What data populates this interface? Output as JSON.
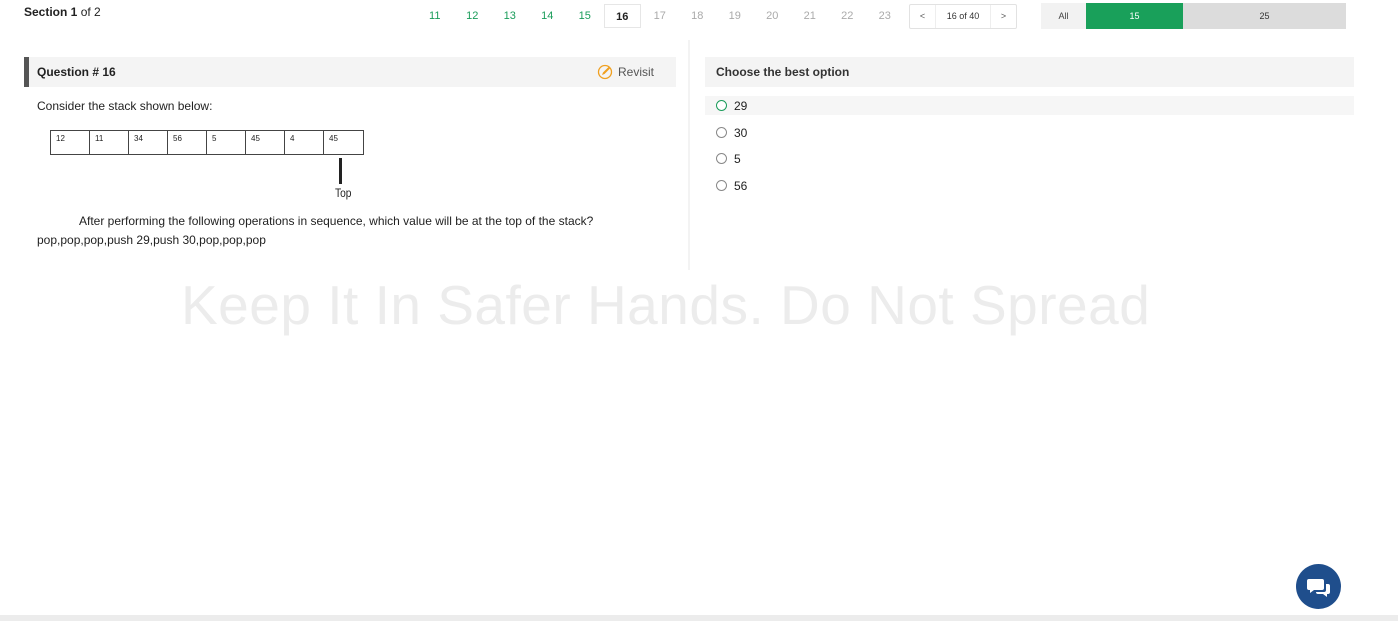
{
  "section": {
    "bold": "Section 1",
    "rest": " of 2"
  },
  "question_nav": [
    {
      "label": "11",
      "state": "answered"
    },
    {
      "label": "12",
      "state": "answered"
    },
    {
      "label": "13",
      "state": "answered"
    },
    {
      "label": "14",
      "state": "answered"
    },
    {
      "label": "15",
      "state": "answered"
    },
    {
      "label": "16",
      "state": "current"
    },
    {
      "label": "17",
      "state": "unvisited"
    },
    {
      "label": "18",
      "state": "unvisited"
    },
    {
      "label": "19",
      "state": "unvisited"
    },
    {
      "label": "20",
      "state": "unvisited"
    },
    {
      "label": "21",
      "state": "unvisited"
    },
    {
      "label": "22",
      "state": "unvisited"
    },
    {
      "label": "23",
      "state": "unvisited"
    }
  ],
  "pager": {
    "prev": "<",
    "text": "16 of 40",
    "next": ">"
  },
  "filter": {
    "all": "All",
    "answered": "15",
    "remaining": "25"
  },
  "question": {
    "title": "Question # 16",
    "revisit": "Revisit",
    "intro": "Consider the stack shown below:",
    "stack": [
      "12",
      "11",
      "34",
      "56",
      "5",
      "45",
      "4",
      "45"
    ],
    "top_label": "Top",
    "body": "After performing the following operations in sequence, which value will be at the top of the stack?",
    "operations": "pop,pop,pop,push 29,push 30,pop,pop,pop"
  },
  "options": {
    "title": "Choose the best option",
    "items": [
      "29",
      "30",
      "5",
      "56"
    ]
  },
  "watermark": "Keep It In Safer Hands. Do Not Spread",
  "colors": {
    "answered": "#1a9c5a",
    "accent_green": "#19a05a",
    "chat": "#1f4e8c"
  }
}
